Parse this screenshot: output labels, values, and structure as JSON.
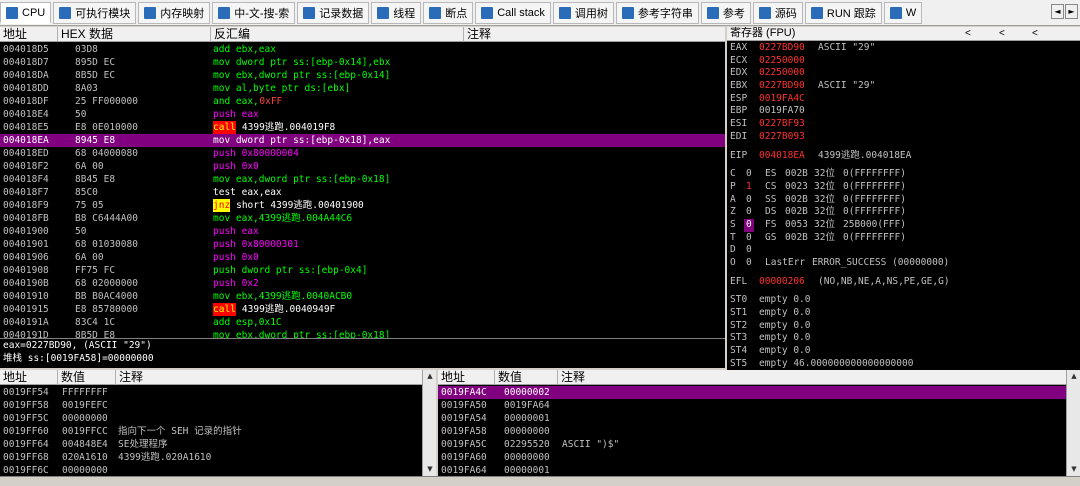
{
  "tabs": [
    {
      "label": "CPU",
      "icon": "cpu-icon",
      "active": true
    },
    {
      "label": "可执行模块",
      "icon": "modules-icon"
    },
    {
      "label": "内存映射",
      "icon": "memory-map-icon"
    },
    {
      "label": "中-文-搜-索",
      "icon": "chinese-search-icon"
    },
    {
      "label": "记录数据",
      "icon": "log-data-icon"
    },
    {
      "label": "线程",
      "icon": "threads-icon"
    },
    {
      "label": "断点",
      "icon": "breakpoints-icon"
    },
    {
      "label": "Call stack",
      "icon": "call-stack-icon"
    },
    {
      "label": "调用树",
      "icon": "call-tree-icon"
    },
    {
      "label": "参考字符串",
      "icon": "ref-strings-icon"
    },
    {
      "label": "参考",
      "icon": "references-icon"
    },
    {
      "label": "源码",
      "icon": "source-icon"
    },
    {
      "label": "RUN 跟踪",
      "icon": "run-trace-icon"
    },
    {
      "label": "W",
      "icon": "windows-icon"
    }
  ],
  "tab_arrows": [
    "◄",
    "►"
  ],
  "disasm": {
    "headers": [
      "地址",
      "HEX 数据",
      "反汇编",
      "注释"
    ],
    "rows": [
      {
        "addr": "004018D5",
        "hex": "03D8",
        "asm": "add ebx,eax",
        "style": "kw"
      },
      {
        "addr": "004018D7",
        "hex": "895D EC",
        "asm": "mov dword ptr ss:[ebp-0x14],ebx",
        "style": "kw"
      },
      {
        "addr": "004018DA",
        "hex": "8B5D EC",
        "asm": "mov ebx,dword ptr ss:[ebp-0x14]",
        "style": "kw"
      },
      {
        "addr": "004018DD",
        "hex": "8A03",
        "asm": "mov al,byte ptr ds:[ebx]",
        "style": "kw"
      },
      {
        "addr": "004018DF",
        "hex": "25 FF000000",
        "asm": "and eax,",
        "num": "0xFF",
        "style": "kwnum"
      },
      {
        "addr": "004018E4",
        "hex": "50",
        "asm": "push eax",
        "style": "push"
      },
      {
        "addr": "004018E5",
        "hex": "E8 0E010000",
        "mn": "call",
        "asm": " 4399逃跑.004019F8",
        "style": "call"
      },
      {
        "addr": "004018EA",
        "hex": "8945 E8",
        "asm": "mov dword ptr ss:[ebp-0x18],eax",
        "style": "sel"
      },
      {
        "addr": "004018ED",
        "hex": "68 04000080",
        "asm": "push 0x80000004",
        "style": "push"
      },
      {
        "addr": "004018F2",
        "hex": "6A 00",
        "asm": "push 0x0",
        "style": "push"
      },
      {
        "addr": "004018F4",
        "hex": "8B45 E8",
        "asm": "mov eax,dword ptr ss:[ebp-0x18]",
        "style": "kw"
      },
      {
        "addr": "004018F7",
        "hex": "85C0",
        "asm": "test eax,eax",
        "style": "white"
      },
      {
        "addr": "004018F9",
        "hex": "75 05",
        "mn": "jnz",
        "asm": " short 4399逃跑.00401900",
        "style": "jnz"
      },
      {
        "addr": "004018FB",
        "hex": "B8 C6444A00",
        "asm": "mov eax,4399逃跑.004A44C6",
        "style": "kw"
      },
      {
        "addr": "00401900",
        "hex": "50",
        "asm": "push eax",
        "style": "push"
      },
      {
        "addr": "00401901",
        "hex": "68 01030080",
        "asm": "push 0x80000301",
        "style": "push"
      },
      {
        "addr": "00401906",
        "hex": "6A 00",
        "asm": "push 0x0",
        "style": "push"
      },
      {
        "addr": "00401908",
        "hex": "FF75 FC",
        "asm": "push dword ptr ss:[ebp-0x4]",
        "style": "kw"
      },
      {
        "addr": "0040190B",
        "hex": "68 02000000",
        "asm": "push 0x2",
        "style": "push"
      },
      {
        "addr": "00401910",
        "hex": "BB B0AC4000",
        "asm": "mov ebx,4399逃跑.0040ACB0",
        "style": "kw"
      },
      {
        "addr": "00401915",
        "hex": "E8 85780000",
        "mn": "call",
        "asm": " 4399逃跑.0040949F",
        "style": "call"
      },
      {
        "addr": "0040191A",
        "hex": "83C4 1C",
        "asm": "add esp,0x1C",
        "style": "kw"
      },
      {
        "addr": "0040191D",
        "hex": "8B5D E8",
        "asm": "mov ebx,dword ptr ss:[ebp-0x18]",
        "style": "kw"
      }
    ]
  },
  "info": {
    "line1": "eax=0227BD90, (ASCII \"29\")",
    "line2": "堆栈 ss:[0019FA58]=00000000"
  },
  "registers": {
    "title": "寄存器 (FPU)",
    "nav": [
      "<",
      "<",
      "<"
    ],
    "gp": [
      {
        "name": "EAX",
        "value": "0227BD90",
        "comment": "ASCII \"29\"",
        "red": true
      },
      {
        "name": "ECX",
        "value": "02250000",
        "comment": "",
        "red": true
      },
      {
        "name": "EDX",
        "value": "02250000",
        "comment": "",
        "red": true
      },
      {
        "name": "EBX",
        "value": "0227BD90",
        "comment": "ASCII \"29\"",
        "red": true
      },
      {
        "name": "ESP",
        "value": "0019FA4C",
        "comment": "",
        "red": true
      },
      {
        "name": "EBP",
        "value": "0019FA70",
        "comment": "",
        "red": false
      },
      {
        "name": "ESI",
        "value": "0227BF93",
        "comment": "",
        "red": true
      },
      {
        "name": "EDI",
        "value": "0227B093",
        "comment": "",
        "red": true
      }
    ],
    "eip": {
      "name": "EIP",
      "value": "004018EA",
      "comment": "4399逃跑.004018EA"
    },
    "flags": [
      {
        "f": "C",
        "v": "0",
        "seg": "ES",
        "sel": "002B",
        "bits": "32位",
        "base": "0(FFFFFFFF)"
      },
      {
        "f": "P",
        "v": "1",
        "seg": "CS",
        "sel": "0023",
        "bits": "32位",
        "base": "0(FFFFFFFF)",
        "red": true
      },
      {
        "f": "A",
        "v": "0",
        "seg": "SS",
        "sel": "002B",
        "bits": "32位",
        "base": "0(FFFFFFFF)"
      },
      {
        "f": "Z",
        "v": "0",
        "seg": "DS",
        "sel": "002B",
        "bits": "32位",
        "base": "0(FFFFFFFF)"
      },
      {
        "f": "S",
        "v": "0",
        "seg": "FS",
        "sel": "0053",
        "bits": "32位",
        "base": "25B000(FFF)",
        "hl": true
      },
      {
        "f": "T",
        "v": "0",
        "seg": "GS",
        "sel": "002B",
        "bits": "32位",
        "base": "0(FFFFFFFF)"
      },
      {
        "f": "D",
        "v": "0",
        "seg": "",
        "sel": "",
        "bits": "",
        "base": ""
      },
      {
        "f": "O",
        "v": "0",
        "seg": "LastErr",
        "sel": "ERROR_SUCCESS (00000000)",
        "bits": "",
        "base": ""
      }
    ],
    "efl": {
      "name": "EFL",
      "value": "00000206",
      "comment": "(NO,NB,NE,A,NS,PE,GE,G)"
    },
    "fpu": [
      {
        "name": "ST0",
        "value": "empty 0.0"
      },
      {
        "name": "ST1",
        "value": "empty 0.0"
      },
      {
        "name": "ST2",
        "value": "empty 0.0"
      },
      {
        "name": "ST3",
        "value": "empty 0.0"
      },
      {
        "name": "ST4",
        "value": "empty 0.0"
      },
      {
        "name": "ST5",
        "value": "empty 46.000000000000000000"
      }
    ]
  },
  "dump": {
    "headers": [
      "地址",
      "数值",
      "注释"
    ],
    "rows": [
      {
        "addr": "0019FF54",
        "val": "FFFFFFFF",
        "comment": ""
      },
      {
        "addr": "0019FF58",
        "val": "0019FEFC",
        "comment": ""
      },
      {
        "addr": "0019FF5C",
        "val": "00000000",
        "comment": ""
      },
      {
        "addr": "0019FF60",
        "val": "0019FFCC",
        "comment": "指向下一个 SEH 记录的指针"
      },
      {
        "addr": "0019FF64",
        "val": "004848E4",
        "comment": "SE处理程序"
      },
      {
        "addr": "0019FF68",
        "val": "020A1610",
        "comment": "4399逃跑.020A1610"
      },
      {
        "addr": "0019FF6C",
        "val": "00000000",
        "comment": ""
      }
    ]
  },
  "stack": {
    "headers": [
      "地址",
      "数值",
      "注释"
    ],
    "rows": [
      {
        "addr": "0019FA4C",
        "val": "00000002",
        "comment": "",
        "sel": true
      },
      {
        "addr": "0019FA50",
        "val": "0019FA64",
        "comment": ""
      },
      {
        "addr": "0019FA54",
        "val": "00000001",
        "comment": ""
      },
      {
        "addr": "0019FA58",
        "val": "00000000",
        "comment": ""
      },
      {
        "addr": "0019FA5C",
        "val": "02295520",
        "comment": "ASCII \")$\""
      },
      {
        "addr": "0019FA60",
        "val": "00000000",
        "comment": ""
      },
      {
        "addr": "0019FA64",
        "val": "00000001",
        "comment": ""
      }
    ]
  },
  "colors": {
    "select": "#800080",
    "call_bg": "#ff0000",
    "jnz_bg": "#ffff00",
    "mnemonic": "#00ff00",
    "push": "#ff00ff",
    "register_changed": "#ff3030"
  }
}
